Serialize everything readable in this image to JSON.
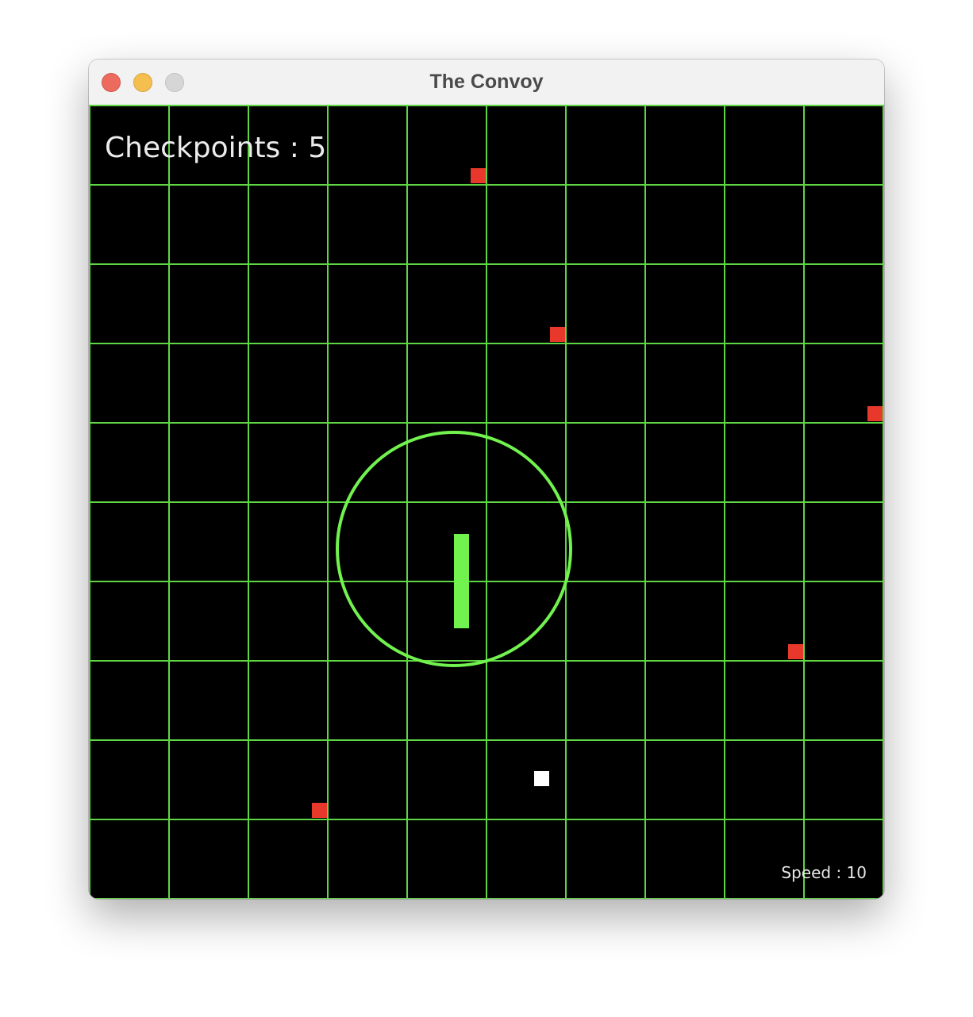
{
  "window": {
    "title": "The Convoy"
  },
  "hud": {
    "checkpoints_label": "Checkpoints : 5",
    "speed_label": "Speed : 10"
  },
  "colors": {
    "grid": "#5fd744",
    "board_background": "#000000",
    "checkpoint": "#e8382b",
    "player": "#ffffff",
    "convoy": "#72f24e"
  },
  "game": {
    "grid": {
      "columns": 10,
      "rows": 10
    },
    "checkpoints": [
      {
        "col": 4,
        "row": 0
      },
      {
        "col": 5,
        "row": 2
      },
      {
        "col": 9,
        "row": 3
      },
      {
        "col": 8,
        "row": 6
      },
      {
        "col": 2,
        "row": 8
      }
    ],
    "player": {
      "col": 5,
      "row": 8
    },
    "convoy": {
      "heading": "vertical"
    }
  }
}
